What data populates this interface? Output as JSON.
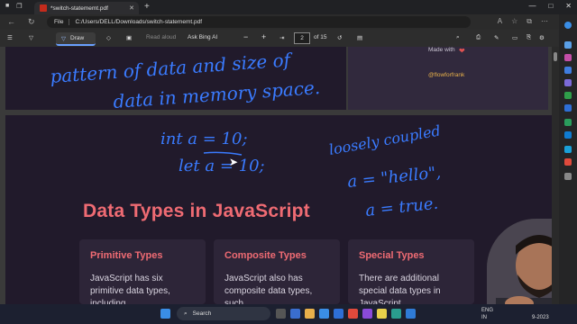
{
  "browser": {
    "tab_title": "*switch-statememt.pdf",
    "new_tab_symbol": "+",
    "file_label": "File",
    "address": "C:/Users/DELL/Downloads/switch-statememt.pdf"
  },
  "pdf_toolbar": {
    "draw_label": "Draw",
    "read_aloud_label": "Read aloud",
    "ask_bing_label": "Ask Bing AI",
    "zoom_out": "−",
    "zoom_in": "+",
    "current_page": "2",
    "page_total": "of 15"
  },
  "page1": {
    "handwriting_line1": "pattern of data and size of",
    "handwriting_line2": "data in memory space.",
    "made_with": "Made with",
    "handle": "@flowforfrank"
  },
  "page2": {
    "handwriting_code1": "int a = 10;",
    "handwriting_code2": "let a = 10;",
    "handwriting_note1": "loosely coupled",
    "handwriting_note2": "a = \"hello\",",
    "handwriting_note3": "a = true.",
    "heading": "Data Types in JavaScript",
    "cards": [
      {
        "title": "Primitive Types",
        "text": "JavaScript has six primitive data types, including"
      },
      {
        "title": "Composite Types",
        "text": "JavaScript also has composite data types, such"
      },
      {
        "title": "Special Types",
        "text": "There are additional special data types in JavaScript,"
      }
    ]
  },
  "taskbar": {
    "search_label": "Search",
    "lang_top": "ENG",
    "lang_bottom": "IN",
    "date_fragment": "9-2023"
  },
  "colors": {
    "accent_heading": "#ef6b73",
    "ink": "#3a7bff",
    "slide_bg": "#211a2b",
    "handle": "#e9b24a"
  }
}
